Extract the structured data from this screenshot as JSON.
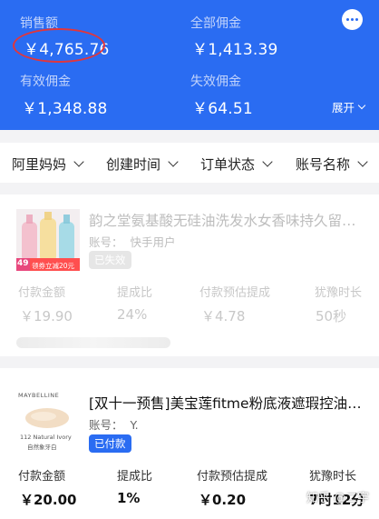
{
  "header": {
    "sales_label": "销售额",
    "sales_value": "￥4,765.76",
    "total_commission_label": "全部佣金",
    "total_commission_value": "￥1,413.39",
    "valid_commission_label": "有效佣金",
    "valid_commission_value": "￥1,348.88",
    "invalid_commission_label": "失效佣金",
    "invalid_commission_value": "￥64.51",
    "expand_label": "展开",
    "colors": {
      "header_bg": "#2a6cf2",
      "highlight_oval": "#e2363b"
    }
  },
  "filters": [
    {
      "label": "阿里妈妈"
    },
    {
      "label": "创建时间"
    },
    {
      "label": "订单状态"
    },
    {
      "label": "账号名称"
    }
  ],
  "orders": [
    {
      "title": "韵之堂氨基酸无硅油洗发水女香味持久留…",
      "account_label": "账号：",
      "account_value": "快手用户",
      "status": "已失效",
      "thumb_badge_num": "49",
      "thumb_badge_text": "领券立减20元",
      "metrics": [
        {
          "label": "付款金额",
          "value": "￥19.90"
        },
        {
          "label": "提成比",
          "value": "24%"
        },
        {
          "label": "付款预估提成",
          "value": "￥4.78"
        },
        {
          "label": "犹豫时长",
          "value": "50秒"
        }
      ]
    },
    {
      "title": "[双十一预售]美宝莲fitme粉底液遮瑕控油…",
      "account_label": "账号：",
      "account_value": "Y.",
      "status": "已付款",
      "thumb_brand": "MAYBELLINE",
      "thumb_caption_1": "112 Natural Ivory",
      "thumb_caption_2": "自然象牙白",
      "metrics": [
        {
          "label": "付款金额",
          "value": "￥20.00"
        },
        {
          "label": "提成比",
          "value": "1%"
        },
        {
          "label": "付款预估提成",
          "value": "￥0.20"
        },
        {
          "label": "犹豫时长",
          "value": "7时12分"
        }
      ]
    }
  ],
  "watermark": "知乎 @二宇"
}
